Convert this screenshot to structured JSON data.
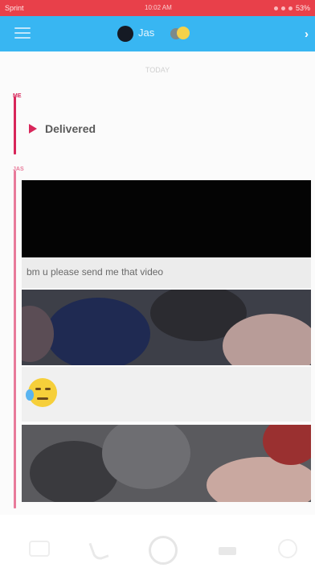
{
  "status_bar": {
    "carrier": "Sprint",
    "time": "10:02 AM",
    "battery": "53%"
  },
  "header": {
    "contact_name": "Jas",
    "accent_color": "#38b6f2"
  },
  "conversation": {
    "date_top": "TODAY",
    "sender_me": "ME",
    "delivered_label": "Delivered",
    "sender_them": "JAS",
    "caption": "bm u please send me that video",
    "accent_me": "#d8265a",
    "accent_them": "#e87a9a"
  },
  "bottom_bar": {
    "icons": [
      "camera-roll-icon",
      "phone-icon",
      "capture-button",
      "video-call-icon",
      "emoji-icon"
    ]
  }
}
